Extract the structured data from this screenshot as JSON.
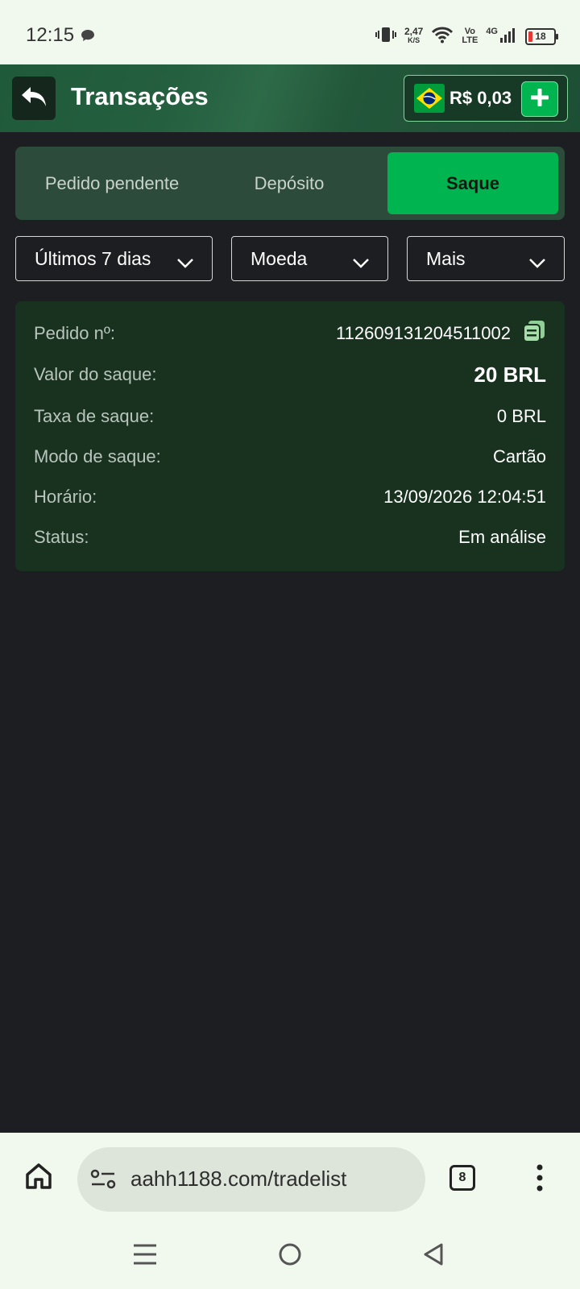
{
  "status_bar": {
    "time": "12:15",
    "net_speed_value": "2,47",
    "net_speed_unit": "K/S",
    "volte_top": "Vo",
    "volte_bottom": "LTE",
    "network": "4G",
    "battery": "18"
  },
  "header": {
    "title": "Transações",
    "balance": "R$ 0,03"
  },
  "tabs": [
    {
      "label": "Pedido pendente",
      "active": false
    },
    {
      "label": "Depósito",
      "active": false
    },
    {
      "label": "Saque",
      "active": true
    }
  ],
  "filters": {
    "period": "Últimos 7 dias",
    "currency": "Moeda",
    "more": "Mais"
  },
  "transaction": {
    "order_label": "Pedido nº:",
    "order_value": "112609131204511002",
    "amount_label": "Valor do saque:",
    "amount_value": "20 BRL",
    "fee_label": "Taxa de saque:",
    "fee_value": "0 BRL",
    "mode_label": "Modo de saque:",
    "mode_value": "Cartão",
    "time_label": "Horário:",
    "time_value": "13/09/2026 12:04:51",
    "status_label": "Status:",
    "status_value": "Em análise"
  },
  "browser": {
    "url": "aahh1188.com/tradelist",
    "tab_count": "8"
  },
  "colors": {
    "accent_green": "#00b450",
    "background": "#1d1e22",
    "card": "#18321f",
    "header": "#245f3f"
  }
}
